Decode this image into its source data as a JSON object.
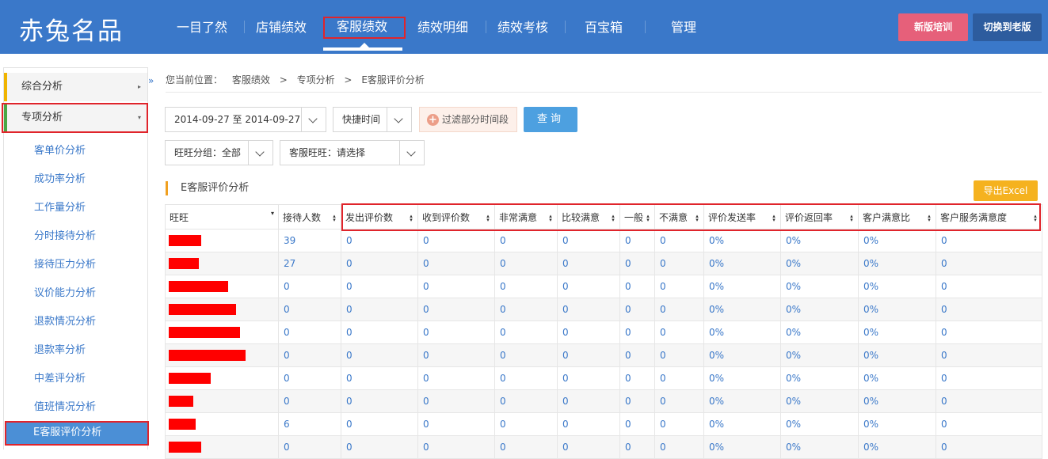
{
  "header": {
    "logo": "赤兔名品",
    "nav": [
      {
        "label": "一目了然"
      },
      {
        "label": "店铺绩效"
      },
      {
        "label": "客服绩效"
      },
      {
        "label": "绩效明细"
      },
      {
        "label": "绩效考核"
      },
      {
        "label": "百宝箱"
      },
      {
        "label": "管理"
      }
    ],
    "active_nav": "客服绩效",
    "btn_training": "新版培训",
    "btn_old": "切换到老版"
  },
  "sidebar": {
    "groups": [
      {
        "label": "综合分析",
        "arrow": "▸"
      },
      {
        "label": "专项分析",
        "arrow": "▾"
      }
    ],
    "items": [
      {
        "label": "客单价分析"
      },
      {
        "label": "成功率分析"
      },
      {
        "label": "工作量分析"
      },
      {
        "label": "分时接待分析"
      },
      {
        "label": "接待压力分析"
      },
      {
        "label": "议价能力分析"
      },
      {
        "label": "退款情况分析"
      },
      {
        "label": "退款率分析"
      },
      {
        "label": "中差评分析"
      },
      {
        "label": "值班情况分析"
      }
    ],
    "active_item": "E客服评价分析",
    "collapse_glyph": "»"
  },
  "breadcrumb": {
    "prefix": "您当前位置：",
    "path": [
      "客服绩效",
      ">",
      "专项分析",
      ">",
      "E客服评价分析"
    ]
  },
  "filters": {
    "date_range": "2014-09-27 至 2014-09-27",
    "quick_time": "快捷时间",
    "exclude_period": "过滤部分时间段",
    "query": "查询",
    "wangwang_group": "旺旺分组：全部",
    "service_wangwang": "客服旺旺：请选择"
  },
  "section": {
    "title": "E客服评价分析",
    "export": "导出Excel"
  },
  "table": {
    "columns": [
      "旺旺",
      "接待人数",
      "发出评价数",
      "收到评价数",
      "非常满意",
      "比较满意",
      "一般",
      "不满意",
      "评价发送率",
      "评价返回率",
      "客户满意比",
      "客户服务满意度"
    ],
    "first_col_sort": "▾",
    "sort_glyph": "▴▾",
    "rows": [
      {
        "redacted": 0.36,
        "cells": [
          "39",
          "0",
          "0",
          "0",
          "0",
          "0",
          "0",
          "0%",
          "0%",
          "0%",
          "0"
        ]
      },
      {
        "redacted": 0.34,
        "cells": [
          "27",
          "0",
          "0",
          "0",
          "0",
          "0",
          "0",
          "0%",
          "0%",
          "0%",
          "0"
        ]
      },
      {
        "redacted": 0.66,
        "cells": [
          "0",
          "0",
          "0",
          "0",
          "0",
          "0",
          "0",
          "0%",
          "0%",
          "0%",
          "0"
        ]
      },
      {
        "redacted": 0.75,
        "cells": [
          "0",
          "0",
          "0",
          "0",
          "0",
          "0",
          "0",
          "0%",
          "0%",
          "0%",
          "0"
        ]
      },
      {
        "redacted": 0.8,
        "cells": [
          "0",
          "0",
          "0",
          "0",
          "0",
          "0",
          "0",
          "0%",
          "0%",
          "0%",
          "0"
        ]
      },
      {
        "redacted": 0.86,
        "cells": [
          "0",
          "0",
          "0",
          "0",
          "0",
          "0",
          "0",
          "0%",
          "0%",
          "0%",
          "0"
        ]
      },
      {
        "redacted": 0.47,
        "cells": [
          "0",
          "0",
          "0",
          "0",
          "0",
          "0",
          "0",
          "0%",
          "0%",
          "0%",
          "0"
        ]
      },
      {
        "redacted": 0.27,
        "cells": [
          "0",
          "0",
          "0",
          "0",
          "0",
          "0",
          "0",
          "0%",
          "0%",
          "0%",
          "0"
        ]
      },
      {
        "redacted": 0.3,
        "cells": [
          "6",
          "0",
          "0",
          "0",
          "0",
          "0",
          "0",
          "0%",
          "0%",
          "0%",
          "0"
        ]
      },
      {
        "redacted": 0.36,
        "cells": [
          "0",
          "0",
          "0",
          "0",
          "0",
          "0",
          "0",
          "0%",
          "0%",
          "0%",
          "0"
        ]
      }
    ]
  },
  "colors": {
    "header_bg": "#3a78c9",
    "highlight_red": "#e0242b",
    "link_blue": "#3a78c9",
    "redaction": "#ff0000"
  }
}
